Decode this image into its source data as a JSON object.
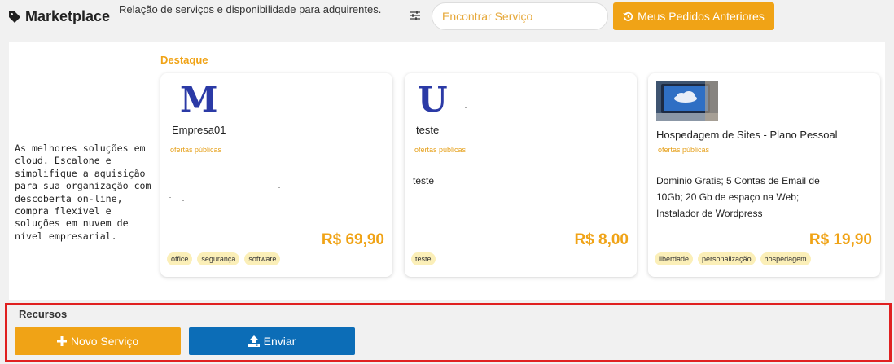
{
  "header": {
    "title": "Marketplace",
    "subtitle": "Relação de serviços e disponibilidade para adquirentes.",
    "search_placeholder": "Encontrar Serviço",
    "orders_button": "Meus Pedidos Anteriores"
  },
  "intro_text": "As melhores soluções em cloud. Escalone e simplifique a aquisição para sua organização com descoberta on-line, compra flexível e soluções em nuvem de nível empresarial.",
  "featured_label": "Destaque",
  "cards": [
    {
      "logo": "M",
      "name": "Empresa01",
      "category": "ofertas públicas",
      "description": "",
      "price": "R$ 69,90",
      "tags": [
        "office",
        "segurança",
        "software"
      ]
    },
    {
      "logo": "U",
      "name": "teste",
      "category": "ofertas públicas",
      "description": "teste",
      "price": "R$ 8,00",
      "tags": [
        "teste"
      ]
    },
    {
      "logo": "",
      "name": "Hospedagem de Sites - Plano Pessoal",
      "category": "ofertas públicas",
      "description": "Dominio Gratis; 5 Contas de Email de 10Gb; 20 Gb de espaço na Web; Instalador de Wordpress",
      "price": "R$ 19,90",
      "tags": [
        "liberdade",
        "personalização",
        "hospedagem"
      ]
    }
  ],
  "resources": {
    "legend": "Recursos",
    "new_service_button": "Novo Serviço",
    "send_button": "Enviar"
  },
  "colors": {
    "accent": "#f0a316",
    "primary_blue": "#0c6db7",
    "highlight_border": "#e02020",
    "tag_bg": "#fbefb8"
  },
  "icons": [
    "tag-icon",
    "filter-icon",
    "history-icon",
    "plus-icon",
    "upload-icon"
  ]
}
